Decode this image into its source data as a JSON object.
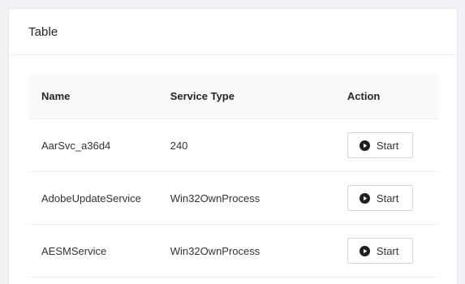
{
  "card": {
    "title": "Table"
  },
  "table": {
    "columns": [
      "Name",
      "Service Type",
      "Action"
    ],
    "rows": [
      {
        "name": "AarSvc_a36d4",
        "service_type": "240",
        "action_label": "Start",
        "action_icon": "play-circle-icon"
      },
      {
        "name": "AdobeUpdateService",
        "service_type": "Win32OwnProcess",
        "action_label": "Start",
        "action_icon": "play-circle-icon"
      },
      {
        "name": "AESMService",
        "service_type": "Win32OwnProcess",
        "action_label": "Start",
        "action_icon": "play-circle-icon"
      }
    ]
  },
  "colors": {
    "page_background": "#f0f2f5",
    "card_background": "#ffffff",
    "header_background": "#fafafa",
    "border": "#f0f0f0",
    "button_border": "#d9d9d9"
  }
}
